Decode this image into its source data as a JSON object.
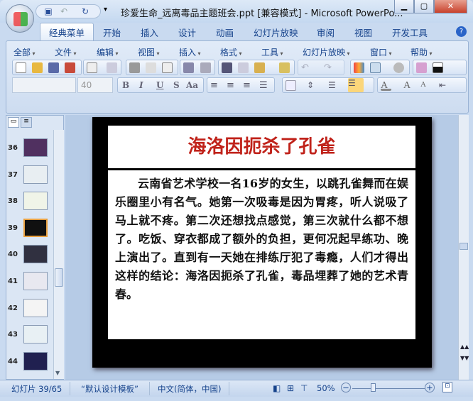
{
  "window": {
    "title": "珍爱生命_远离毒品主题班会.ppt [兼容模式] - Microsoft PowerPo..."
  },
  "tabs": [
    "经典菜单",
    "开始",
    "插入",
    "设计",
    "动画",
    "幻灯片放映",
    "审阅",
    "视图",
    "开发工具"
  ],
  "menus": [
    "全部",
    "文件",
    "编辑",
    "视图",
    "插入",
    "格式",
    "工具",
    "幻灯片放映",
    "窗口",
    "帮助"
  ],
  "format": {
    "font_size": "40",
    "bold": "B",
    "italic": "I",
    "underline": "U",
    "shadow": "S",
    "case": "Aa"
  },
  "panel_tabs": [
    "幻灯片",
    "大纲"
  ],
  "thumbnails": [
    {
      "num": "36"
    },
    {
      "num": "37"
    },
    {
      "num": "38"
    },
    {
      "num": "39",
      "selected": true
    },
    {
      "num": "40"
    },
    {
      "num": "41"
    },
    {
      "num": "42"
    },
    {
      "num": "43"
    },
    {
      "num": "44"
    }
  ],
  "slide": {
    "title": "海洛因扼杀了孔雀",
    "body": "云南省艺术学校一名16岁的女生，以跳孔雀舞而在娱乐圈里小有名气。她第一次吸毒是因为胃疼，听人说吸了马上就不疼。第二次还想找点感觉，第三次就什么都不想了。吃饭、穿衣都成了额外的负担，更何况起早练功、晚上演出了。直到有一天她在排练厅犯了毒瘾，人们才得出这样的结论：海洛因扼杀了孔雀，毒品埋葬了她的艺术青春。"
  },
  "status": {
    "slide": "幻灯片 39/65",
    "template": "“默认设计模板”",
    "language": "中文(简体，中国)",
    "zoom": "50%",
    "zoom_value": 50
  },
  "colors": {
    "title_red": "#c0221a",
    "accent": "#15428b"
  }
}
